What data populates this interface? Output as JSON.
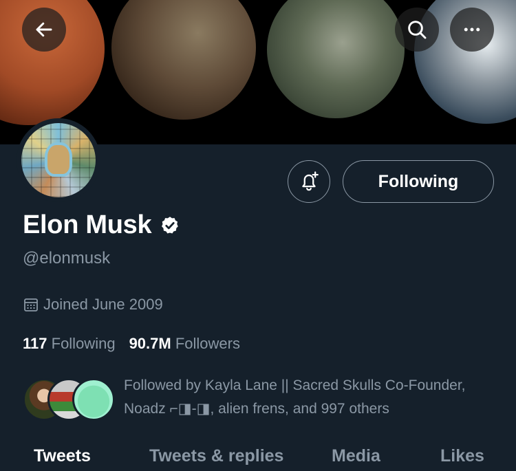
{
  "banner": {
    "alt": ""
  },
  "header": {
    "back_icon": "arrow-left-icon",
    "search_icon": "search-icon",
    "more_icon": "more-horizontal-icon"
  },
  "actions": {
    "notify_icon": "bell-plus-icon",
    "following_label": "Following"
  },
  "profile": {
    "name": "Elon Musk",
    "verified_icon": "verified-badge-icon",
    "handle": "@elonmusk",
    "joined": "Joined June 2009",
    "following_count": "117",
    "following_label": "Following",
    "followers_count": "90.7M",
    "followers_label": "Followers"
  },
  "followed_by": {
    "text": "Followed by Kayla Lane || Sacred Skulls Co-Founder, Noadz ⌐◨-◨, alien frens, and 997 others"
  },
  "tabs": [
    {
      "label": "Tweets",
      "active": true
    },
    {
      "label": "Tweets & replies",
      "active": false
    },
    {
      "label": "Media",
      "active": false
    },
    {
      "label": "Likes",
      "active": false
    }
  ],
  "colors": {
    "background": "#15202b",
    "secondary_text": "#8b98a5",
    "primary_text": "#ffffff"
  }
}
